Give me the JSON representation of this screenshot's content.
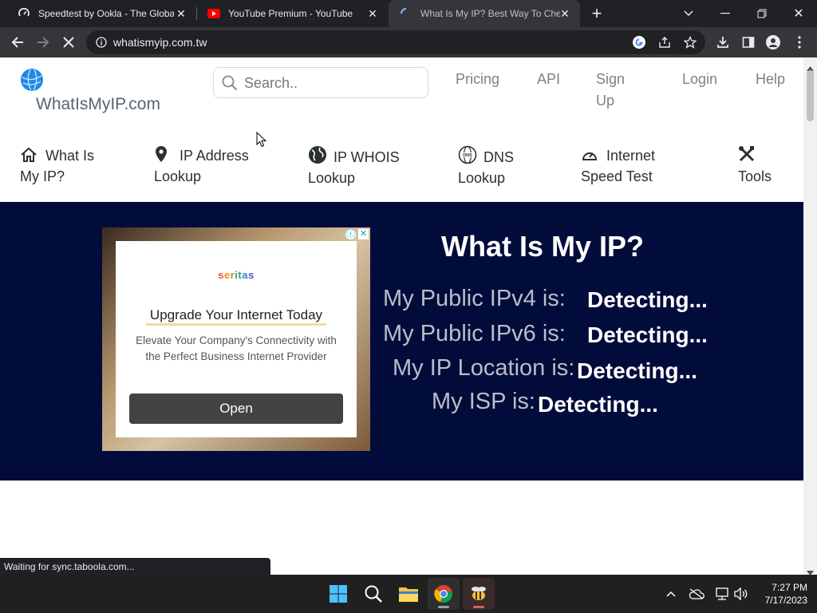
{
  "browser": {
    "tabs": [
      {
        "title": "Speedtest by Ookla - The Global",
        "icon": "speedtest-icon"
      },
      {
        "title": "YouTube Premium - YouTube",
        "icon": "youtube-icon"
      },
      {
        "title": "What Is My IP? Best Way To Chec",
        "icon": "loading-spinner-icon",
        "active": true
      }
    ],
    "url": "whatismyip.com.tw",
    "status": "Waiting for sync.taboola.com..."
  },
  "site": {
    "logo_text": "WhatIsMyIP.com",
    "search_placeholder": "Search..",
    "top_links": {
      "pricing": "Pricing",
      "api": "API",
      "signup_1": "Sign",
      "signup_2": "Up",
      "login": "Login",
      "help": "Help"
    },
    "nav": [
      {
        "line1": "What Is",
        "line2": "My IP?",
        "icon": "home-icon"
      },
      {
        "line1": "IP Address",
        "line2": "Lookup",
        "icon": "map-pin-icon"
      },
      {
        "line1": "IP WHOIS",
        "line2": "Lookup",
        "icon": "globe-icon"
      },
      {
        "line1": "DNS",
        "line2": "Lookup",
        "icon": "dns-globe-icon"
      },
      {
        "line1": "Internet",
        "line2": "Speed Test",
        "icon": "speedometer-icon"
      },
      {
        "line1": "",
        "line2": "Tools",
        "icon": "tools-icon"
      }
    ]
  },
  "ad": {
    "brand": "seritas",
    "headline": "Upgrade Your Internet Today",
    "body": "Elevate Your Company's Connectivity with the Perfect Business Internet Provider",
    "cta": "Open"
  },
  "hero": {
    "title": "What Is My IP?",
    "rows": [
      {
        "label": "My Public IPv4 is:",
        "value": "Detecting..."
      },
      {
        "label": "My Public IPv6 is:",
        "value": "Detecting..."
      },
      {
        "label": "My IP Location is:",
        "value": "Detecting..."
      },
      {
        "label": "My ISP is:",
        "value": "Detecting..."
      }
    ]
  },
  "taskbar": {
    "time": "7:27 PM",
    "date": "7/17/2023"
  },
  "colors": {
    "hero_bg": "#020c3b",
    "logo_blue": "#1e88e5"
  }
}
